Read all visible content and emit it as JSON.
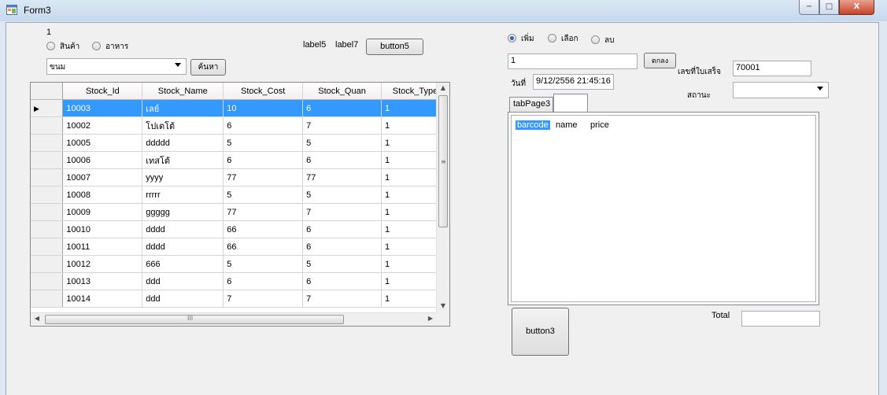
{
  "window": {
    "title": "Form3",
    "minimize": "−",
    "maximize": "□",
    "close": "X"
  },
  "left": {
    "counter": "1",
    "radio_product": "สินค้า",
    "radio_food": "อาหาร",
    "label5": "label5",
    "label7": "label7",
    "button5": "button5",
    "combo_value": "ขนม",
    "search_button": "ค้นหา"
  },
  "grid": {
    "columns": [
      "Stock_Id",
      "Stock_Name",
      "Stock_Cost",
      "Stock_Quan",
      "Stock_Type"
    ],
    "rows": [
      [
        "10003",
        "เลย์",
        "10",
        "6",
        "1"
      ],
      [
        "10002",
        "โปเตโต้",
        "6",
        "7",
        "1"
      ],
      [
        "10005",
        "ddddd",
        "5",
        "5",
        "1"
      ],
      [
        "10006",
        "เทสโต้",
        "6",
        "6",
        "1"
      ],
      [
        "10007",
        "yyyy",
        "77",
        "77",
        "1"
      ],
      [
        "10008",
        "rrrrr",
        "5",
        "5",
        "1"
      ],
      [
        "10009",
        "ggggg",
        "77",
        "7",
        "1"
      ],
      [
        "10010",
        "dddd",
        "66",
        "6",
        "1"
      ],
      [
        "10011",
        "dddd",
        "66",
        "6",
        "1"
      ],
      [
        "10012",
        "666",
        "5",
        "5",
        "1"
      ],
      [
        "10013",
        "ddd",
        "6",
        "6",
        "1"
      ],
      [
        "10014",
        "ddd",
        "7",
        "7",
        "1"
      ]
    ],
    "hscroll_grip": "III"
  },
  "right": {
    "radio_add": "เพิ่ม",
    "radio_select": "เลือก",
    "radio_delete": "ลบ",
    "input_value": "1",
    "ok_button": "ตกลง",
    "receipt_label": "เลขที่ใบเสร็จ",
    "receipt_value": "70001",
    "date_label": "วันที่",
    "date_value": "9/12/2556 21:45:16",
    "status_label": "สถานะ",
    "tab_label": "tabPage3",
    "list_headers": [
      "barcode",
      "name",
      "price"
    ],
    "button3": "button3",
    "total_label": "Total",
    "total_value": ""
  }
}
